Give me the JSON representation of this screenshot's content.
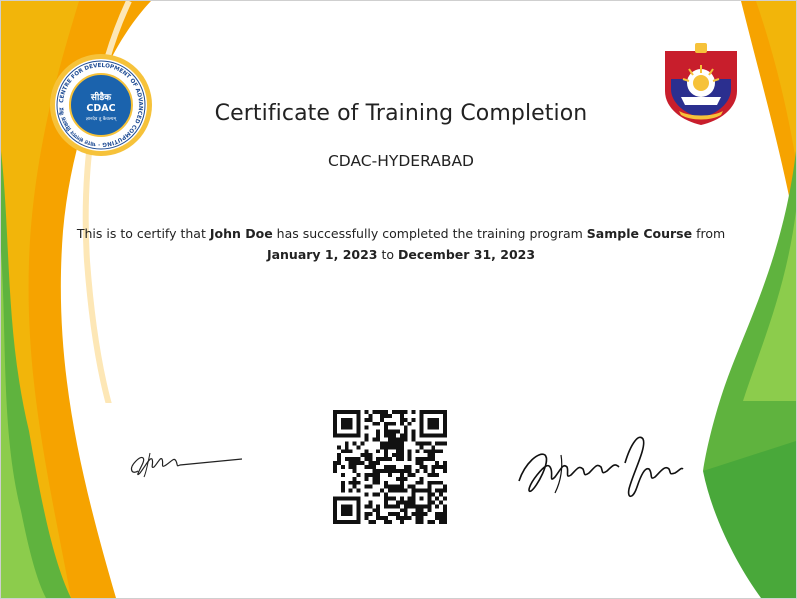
{
  "certificate": {
    "title": "Certificate of Training Completion",
    "organization": "CDAC-HYDERABAD",
    "statement": {
      "prefix": "This is to certify that",
      "name": "John Doe",
      "middle": "has successfully completed the training program",
      "course": "Sample Course",
      "from_word": "from",
      "start_date": "January 1, 2023",
      "to_word": "to",
      "end_date": "December 31, 2023"
    }
  },
  "logos": {
    "left": {
      "icon": "cdac-logo-icon",
      "ring_text": "भारत संगणन विकास केंद्र · CENTRE FOR DEVELOPMENT OF ADVANCED COMPUTING",
      "inner_top": "सीडैक",
      "inner_name": "CDAC",
      "inner_motto": "ज्ञानदेव तु कैवल्यम्"
    },
    "right": {
      "icon": "police-emblem-icon"
    }
  },
  "colors": {
    "saffron": "#f6a300",
    "green": "#49a83a",
    "title_text": "#222222"
  },
  "footer": {
    "left_signature": "signature-image",
    "qr_code": "qr-code-icon",
    "right_signature": "signature-image"
  }
}
